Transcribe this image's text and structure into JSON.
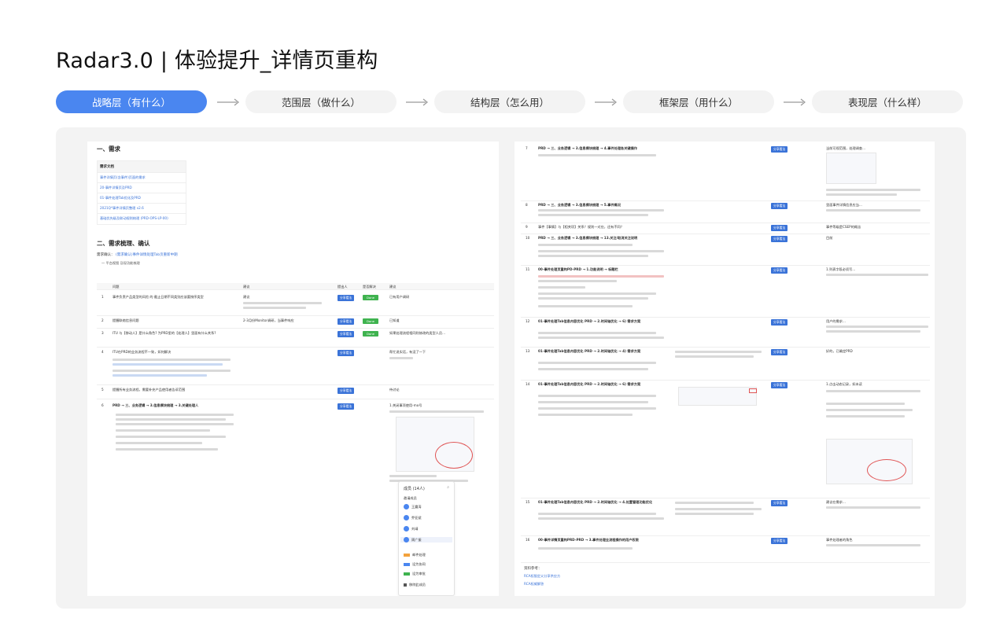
{
  "page": {
    "title": "Radar3.0 | 体验提升_详情页重构"
  },
  "steps": [
    {
      "label": "战略层（有什么）",
      "active": true
    },
    {
      "label": "范围层（做什么）",
      "active": false
    },
    {
      "label": "结构层（怎么用）",
      "active": false
    },
    {
      "label": "框架层（用什么）",
      "active": false
    },
    {
      "label": "表现层（什么样）",
      "active": false
    }
  ],
  "colors": {
    "accent": "#4a86f0",
    "panel": "#f3f3f3",
    "link": "#3a73d8",
    "green": "#3fb34f"
  },
  "left_doc": {
    "section1": "一、需求",
    "req_table_header": "需求文档",
    "req_links": [
      "事件详情页(含事件)页面的需求",
      "20-事件详情页及PRD",
      "01-事件处理Tab优化及PRD",
      "2021Q*事件详情页整理 v2.6",
      "基础优先级及联动规则梳理 (PRD-OPS-LP-00)"
    ],
    "section2": "二、需求梳理、确认",
    "section2_sub": "需求确认：",
    "section2_link": "(需求确认)事件详情处理Tab页重新中期",
    "section2_note": "一 平台视图 及现功能梳理",
    "columns": [
      "问题",
      "建议",
      "提出人",
      "是否解决",
      "建议"
    ],
    "rows": [
      {
        "n": "1",
        "q": "事件负责产品类型的风险 的 截止日期不同类别应该要按序类型",
        "s": "建议",
        "badge": "分享看法",
        "status": "Done",
        "r": "已有用户调研"
      },
      {
        "n": "2",
        "q": "提醒联络信息问题",
        "s": "2-3月份Monitor调研，当事件响应",
        "badge": "分享看法",
        "status": "Done",
        "r": "已知道"
      },
      {
        "n": "3",
        "q": "ITU 与【移动人】是什么角色? 为PRD里的【处理人】里面有什么关系?",
        "s": "",
        "badge": "分享看法",
        "status": "Done",
        "r": "如果处理流程相同则修改的类型人员…"
      },
      {
        "n": "4",
        "q": "ITU在PRD的业务流程不一致，如何解决",
        "s": "",
        "badge": "分享看法",
        "status": "",
        "r": "帮忙说实话，有没了一下"
      },
      {
        "n": "5",
        "q": "提醒所有业务流程，需要补充产品使用者告诉范围",
        "s": "",
        "badge": "分享看法",
        "status": "",
        "r": "待讨论"
      },
      {
        "n": "6",
        "q": "PRD → 三、业务逻辑 → 3.信息模块梳理 → 3.关键处理人",
        "s": "",
        "badge": "分享看法",
        "status": "",
        "r": "1.关闭事项使用-mo号"
      }
    ],
    "popup_title": "成员 (14人)",
    "popup_items": [
      "邀请成员",
      "王震涛",
      "乔亚斌",
      "刘靖",
      "周广振",
      "邮件处理",
      "设为协同",
      "设为审批",
      "移除此成员"
    ]
  },
  "right_doc": {
    "rows": [
      {
        "n": "7",
        "q": "PRD → 三、业务逻辑 → 3.信息模块梳理 → 4.事件处理各关键操作",
        "badge": "分享看法",
        "r": "当前可视范围，处理调查..."
      },
      {
        "n": "8",
        "q": "PRD → 三、业务逻辑 → 3.信息模块梳理 → 5.事件概况",
        "badge": "分享看法",
        "r": "里面事件详情信息应当..."
      },
      {
        "n": "9",
        "q": "事件【事情】与【相关项】关系？规则一对应，还有不同？",
        "badge": "分享看法",
        "r": "事件等级是CSEP的概念"
      },
      {
        "n": "10",
        "q": "PRD → 三、业务逻辑 → 3.信息模块梳理 → 13.关注/取消关注说明",
        "badge": "分享看法",
        "r": "目前"
      },
      {
        "n": "11",
        "q": "00-事件处理页重构PD-PRD → 1.功能说明 → 标题栏",
        "badge": "分享看法",
        "r": "1.列表字段必须写..."
      },
      {
        "n": "12",
        "q": "01-事件处理Tab信息内容优化 PRD → 2.时间轴优化 → 6) 需求方案",
        "badge": "分享看法",
        "r": "用户的需求..."
      },
      {
        "n": "13",
        "q": "01-事件处理Tab信息内容优化 PRD → 2.时间轴优化 → 4) 需求方案",
        "badge": "分享看法",
        "r": "好的，已确定PRD"
      },
      {
        "n": "14",
        "q": "01-事件处理Tab信息内容优化 PRD → 2.时间轴优化 → 6) 需求方案",
        "badge": "分享看法",
        "r": "1.点击动态记录，如未读"
      },
      {
        "n": "15",
        "q": "01-事件处理Tab信息内容优化 PRD → 2.时间轴优化 → 4.处置管理功能优化",
        "badge": "分享看法",
        "r": "建议在需求..."
      },
      {
        "n": "16",
        "q": "00-事件详情页重构PRD-PRD → 3.事件处理全流程操作的用户权限",
        "badge": "分享看法",
        "r": "事件处理者的角色"
      }
    ],
    "ref_title": "资料参考：",
    "refs": [
      "RCA权限定义分享供应方",
      "RCA权威解答"
    ]
  }
}
